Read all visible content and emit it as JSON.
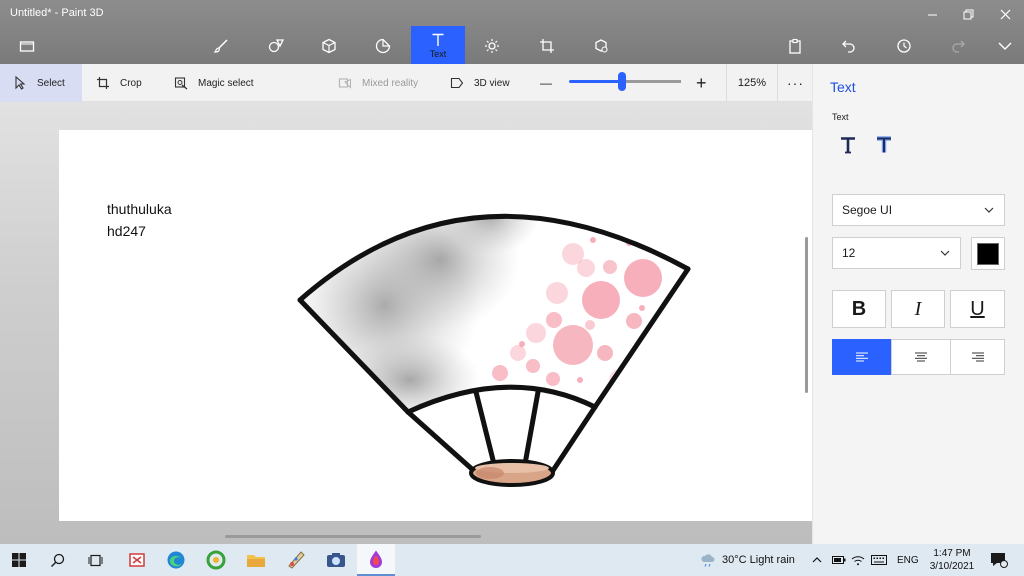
{
  "window": {
    "title": "Untitled* - Paint 3D"
  },
  "toolbar": {
    "tools": [
      {
        "name": "menu-folder-icon"
      },
      {
        "name": "brushes-icon"
      },
      {
        "name": "2d-shapes-icon"
      },
      {
        "name": "3d-shapes-icon"
      },
      {
        "name": "stickers-icon"
      },
      {
        "name": "text-icon",
        "label": "Text",
        "active": true
      },
      {
        "name": "effects-icon"
      },
      {
        "name": "canvas-icon"
      },
      {
        "name": "3d-library-icon"
      }
    ],
    "right_tools": [
      "paste-icon",
      "undo-icon",
      "history-icon",
      "redo-icon",
      "expand-icon"
    ]
  },
  "subbar": {
    "select": "Select",
    "crop": "Crop",
    "magic_select": "Magic select",
    "mixed_reality": "Mixed reality",
    "view_3d": "3D view",
    "zoom_minus": "—",
    "zoom_plus": "+",
    "zoom": "125%",
    "more": "···",
    "zoom_level": 0.47
  },
  "canvas": {
    "text_line1": "thuthuluka",
    "text_line2": "hd247"
  },
  "panel": {
    "title": "Text",
    "subtitle": "Text",
    "font": "Segoe UI",
    "size": "12",
    "color": "#000000",
    "bold": "B",
    "italic": "I",
    "underline": "U"
  },
  "taskbar": {
    "weather": "30°C  Light rain",
    "lang": "ENG",
    "time": "1:47 PM",
    "date": "3/10/2021",
    "notifications": "1"
  },
  "colors": {
    "accent": "#2b62ff",
    "toolbar": "#838383",
    "fan_blossom": "#f17b8d"
  }
}
